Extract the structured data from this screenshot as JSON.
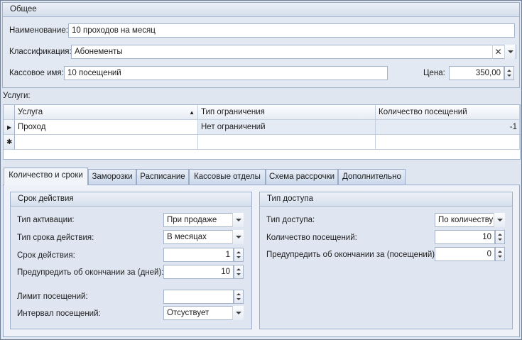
{
  "general": {
    "title": "Общее",
    "name_label": "Наименование:",
    "name_value": "10 проходов на месяц",
    "class_label": "Классификация:",
    "class_value": "Абонементы",
    "cash_label": "Кассовое имя:",
    "cash_value": "10 посещений",
    "price_label": "Цена:",
    "price_value": "350,00"
  },
  "services": {
    "label": "Услуги:",
    "columns": [
      "Услуга",
      "Тип ограничения",
      "Количество посещений"
    ],
    "rows": [
      {
        "service": "Проход",
        "restriction": "Нет ограничений",
        "visits": "-1"
      }
    ]
  },
  "tabs": [
    "Количество и сроки",
    "Заморозки",
    "Расписание",
    "Кассовые отделы",
    "Схема рассрочки",
    "Дополнительно"
  ],
  "validity": {
    "title": "Срок действия",
    "activation_label": "Тип активации:",
    "activation_value": "При продаже",
    "term_type_label": "Тип срока действия:",
    "term_type_value": "В месяцах",
    "term_label": "Срок действия:",
    "term_value": "1",
    "warn_days_label": "Предупредить об окончании за (дней):",
    "warn_days_value": "10",
    "visit_limit_label": "Лимит посещений:",
    "visit_limit_value": "",
    "interval_label": "Интервал посещений:",
    "interval_value": "Отсуствует"
  },
  "access": {
    "title": "Тип доступа",
    "type_label": "Тип доступа:",
    "type_value": "По количеству",
    "visits_label": "Количество посещений:",
    "visits_value": "10",
    "warn_visits_label": "Предупредить об окончании за (посещений):",
    "warn_visits_value": "0"
  }
}
